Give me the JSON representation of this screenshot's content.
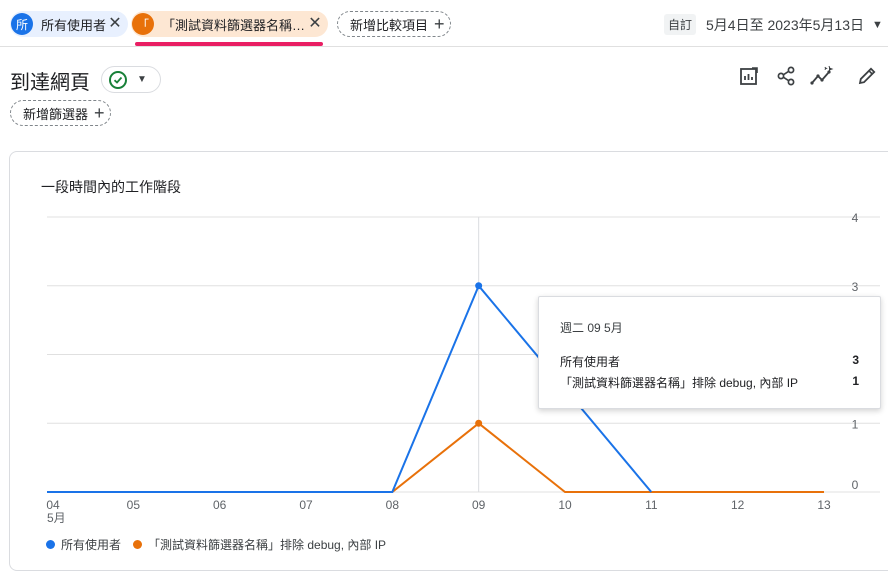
{
  "compare_chips": [
    {
      "avatar": "所",
      "label": "所有使用者",
      "color": "#1a73e8"
    },
    {
      "avatar": "「",
      "label": "「測試資料篩選器名稱…",
      "color": "#e8710a"
    }
  ],
  "add_compare_label": "新增比較項目",
  "date": {
    "badge": "自訂",
    "range": "5月4日至 2023年5月13日"
  },
  "page": {
    "title": "到達網頁",
    "add_filter_label": "新增篩選器"
  },
  "card": {
    "title": "一段時間內的工作階段"
  },
  "chart_data": {
    "type": "line",
    "title": "一段時間內的工作階段",
    "categories": [
      "04",
      "05",
      "06",
      "07",
      "08",
      "09",
      "10",
      "11",
      "12",
      "13"
    ],
    "x_month_label": "5月",
    "ylim": [
      0,
      4
    ],
    "yticks": [
      "0",
      "1",
      "2",
      "3",
      "4"
    ],
    "grid": true,
    "legend_position": "bottom-left",
    "series": [
      {
        "name": "所有使用者",
        "color": "#1a73e8",
        "values": [
          0,
          0,
          0,
          0,
          0,
          3,
          1.5,
          0,
          null,
          null
        ]
      },
      {
        "name": "「測試資料篩選器名稱」排除 debug, 內部 IP",
        "color": "#e8710a",
        "values": [
          0,
          0,
          0,
          0,
          0,
          1,
          0,
          0,
          0,
          0
        ]
      }
    ]
  },
  "tooltip": {
    "date": "週二 09 5月",
    "rows": [
      {
        "label": "所有使用者",
        "value": "3"
      },
      {
        "label": "「測試資料篩選器名稱」排除 debug, 內部 IP",
        "value": "1"
      }
    ]
  },
  "icons": [
    "close-icon",
    "add-icon",
    "dropdown-caret-icon",
    "check-circle-icon",
    "customize-report-icon",
    "share-icon",
    "insights-icon",
    "edit-icon"
  ]
}
